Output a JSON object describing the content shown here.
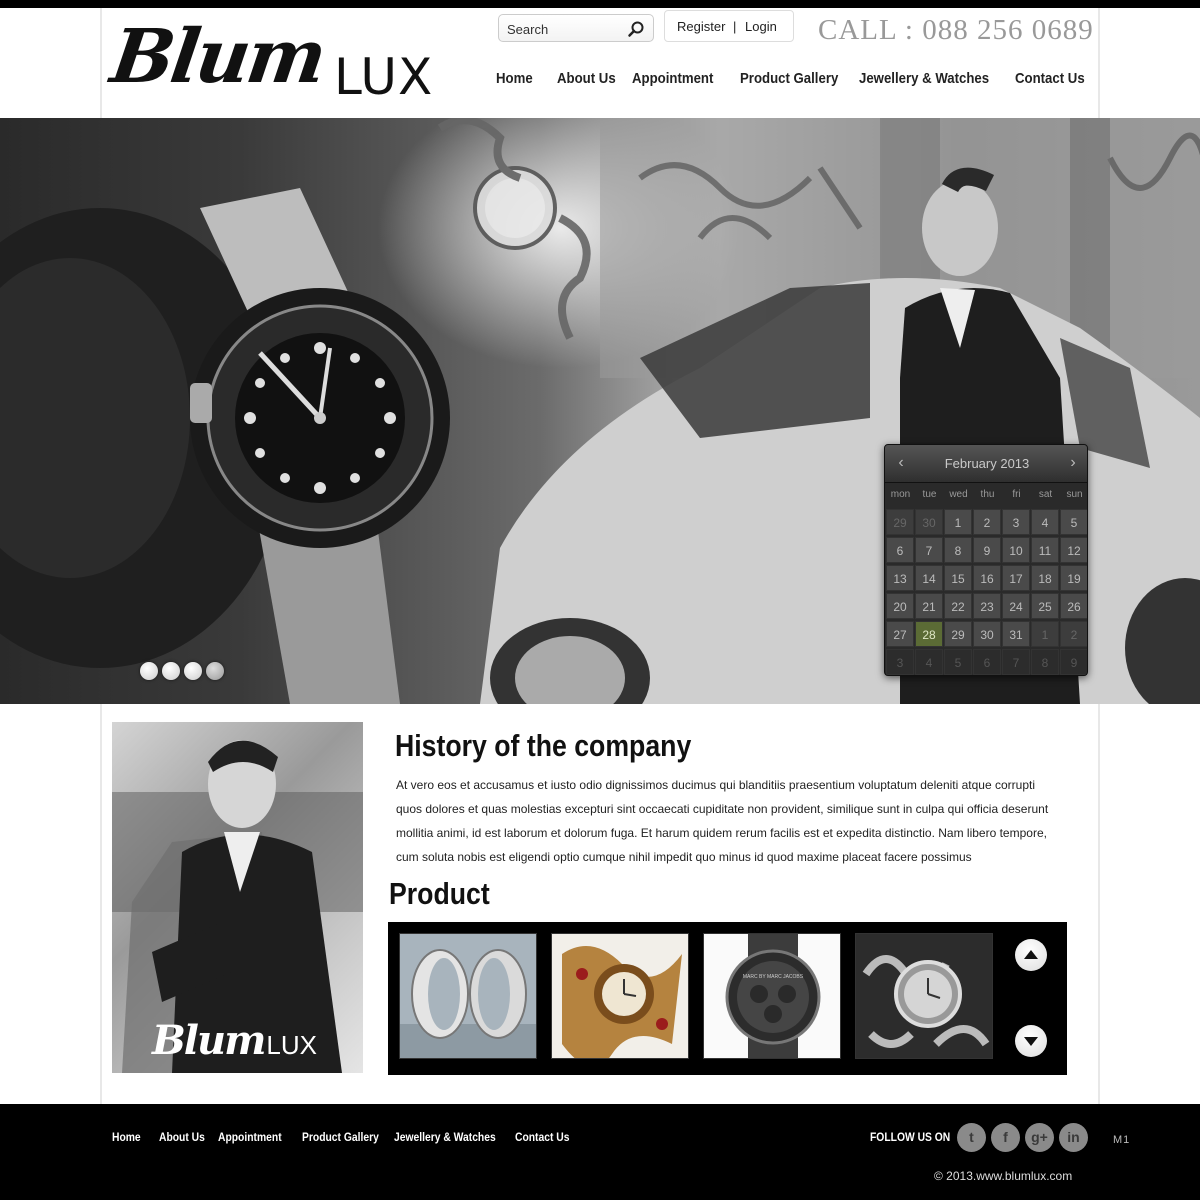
{
  "brand": {
    "script": "Blum",
    "caps": "LUX"
  },
  "header": {
    "search_placeholder": "Search",
    "register": "Register",
    "separator": "|",
    "login": "Login",
    "phone": "CALL : 088 256 0689"
  },
  "nav": [
    "Home",
    "About Us",
    "Appointment",
    "Product Gallery",
    "Jewellery  & Watches",
    "Contact Us"
  ],
  "calendar": {
    "title": "February 2013",
    "prev": "‹",
    "next": "›",
    "weekdays": [
      "mon",
      "tue",
      "wed",
      "thu",
      "fri",
      "sat",
      "sun"
    ],
    "weeks": [
      [
        "29",
        "30",
        "1",
        "2",
        "3",
        "4",
        "5"
      ],
      [
        "6",
        "7",
        "8",
        "9",
        "10",
        "11",
        "12"
      ],
      [
        "13",
        "14",
        "15",
        "16",
        "17",
        "18",
        "19"
      ],
      [
        "20",
        "21",
        "22",
        "23",
        "24",
        "25",
        "26"
      ],
      [
        "27",
        "28",
        "29",
        "30",
        "31",
        "1",
        "2"
      ],
      [
        "3",
        "4",
        "5",
        "6",
        "7",
        "8",
        "9"
      ]
    ],
    "today": "28"
  },
  "slider": {
    "dot_count": 4,
    "active_index": 0
  },
  "history": {
    "heading": "History of the company",
    "text": "At vero eos et accusamus et iusto odio dignissimos ducimus qui blanditiis praesentium voluptatum deleniti atque corrupti quos dolores et quas molestias excepturi sint occaecati cupiditate non provident, similique sunt in culpa qui officia deserunt mollitia animi, id est laborum et dolorum fuga. Et harum quidem rerum facilis est et expedita distinctio. Nam libero tempore, cum soluta nobis est eligendi optio cumque nihil impedit quo minus id quod maxime placeat facere possimus"
  },
  "product": {
    "heading": "Product",
    "items": [
      "rings",
      "ornate gold watch",
      "black chronograph",
      "diamond bracelet watch"
    ],
    "watch_text": "MARC BY MARC JACOBS"
  },
  "footer": {
    "links": [
      "Home",
      "About Us",
      "Appointment",
      "Product Gallery",
      "Jewellery  & Watches",
      "Contact Us"
    ],
    "follow": "FOLLOW US ON",
    "social": [
      {
        "icon": "twitter-icon",
        "glyph": "t"
      },
      {
        "icon": "facebook-icon",
        "glyph": "f"
      },
      {
        "icon": "google-plus-icon",
        "glyph": "g+"
      },
      {
        "icon": "linkedin-icon",
        "glyph": "in"
      }
    ],
    "badge": "M1",
    "copyright": "© 2013.www.blumlux.com"
  }
}
